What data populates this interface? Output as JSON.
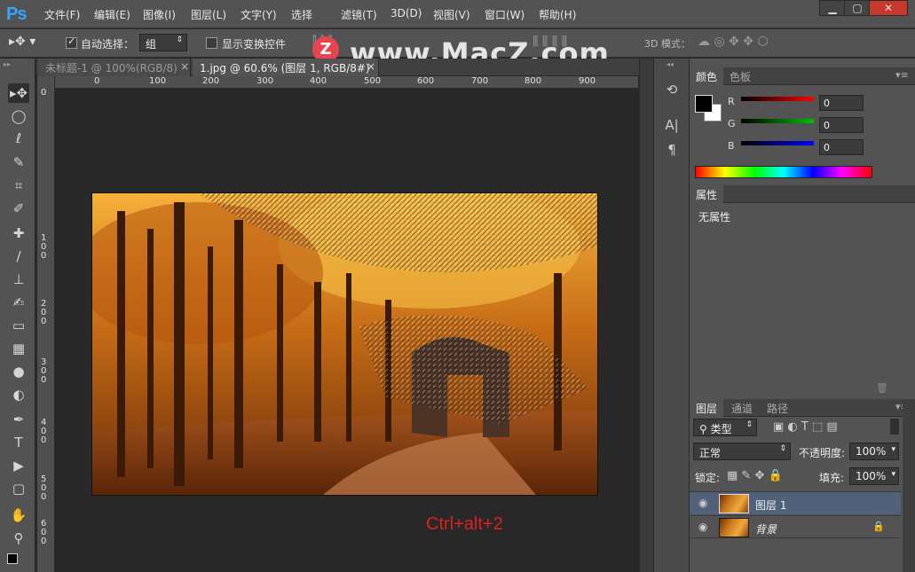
{
  "app": {
    "logo": "Ps"
  },
  "menu": [
    "文件(F)",
    "编辑(E)",
    "图像(I)",
    "图层(L)",
    "文字(Y)",
    "选择",
    "滤镜(T)",
    "3D(D)",
    "视图(V)",
    "窗口(W)",
    "帮助(H)"
  ],
  "window_buttons": [
    "▁",
    "▢",
    "✕"
  ],
  "watermark": {
    "badge": "Z",
    "text": "www.MacZ.com"
  },
  "options": {
    "auto_select_label": "自动选择：",
    "auto_select_value": "组",
    "show_transform_label": "显示变换控件",
    "mode_3d_label": "3D 模式："
  },
  "tabs": [
    {
      "label": "未标题-1 @ 100%(RGB/8)",
      "close": "×"
    },
    {
      "label": "1.jpg @ 60.6% (图层 1, RGB/8#) *",
      "close": "×"
    }
  ],
  "ruler_h": [
    "0",
    "100",
    "200",
    "300",
    "400",
    "500",
    "600",
    "700",
    "800",
    "900"
  ],
  "ruler_v": [
    "0",
    "1 0 0",
    "2 0 0",
    "3 0 0",
    "4 0 0",
    "5 0 0",
    "6 0 0"
  ],
  "hint": "Ctrl+alt+2",
  "color_panel": {
    "tabs": [
      "颜色",
      "色板"
    ],
    "channels": [
      {
        "label": "R",
        "value": "0",
        "color": "#ff0000"
      },
      {
        "label": "G",
        "value": "0",
        "color": "#00c000"
      },
      {
        "label": "B",
        "value": "0",
        "color": "#0000ff"
      }
    ]
  },
  "properties": {
    "tab": "属性",
    "content": "无属性"
  },
  "layers_panel": {
    "tabs": [
      "图层",
      "通道",
      "路径"
    ],
    "filter": "类型",
    "blend_mode": "正常",
    "opacity_label": "不透明度:",
    "opacity_value": "100%",
    "lock_label": "锁定:",
    "fill_label": "填充:",
    "fill_value": "100%",
    "layers": [
      {
        "name": "图层 1",
        "selected": true
      },
      {
        "name": "背景",
        "selected": false
      }
    ]
  },
  "tools": [
    "move",
    "marquee",
    "lasso",
    "quick-select",
    "crop",
    "eyedropper",
    "healing",
    "brush",
    "stamp",
    "history-brush",
    "eraser",
    "gradient",
    "blur",
    "dodge",
    "pen",
    "type",
    "path-select",
    "rectangle",
    "hand",
    "zoom"
  ],
  "tool_glyphs": [
    "▸✥",
    "◯",
    "ℓ",
    "✎",
    "⌗",
    "✐",
    "✚",
    "∕",
    "⊥",
    "✍",
    "▭",
    "▦",
    "●",
    "◐",
    "✒",
    "T",
    "▶",
    "▢",
    "✋",
    "⚲"
  ]
}
